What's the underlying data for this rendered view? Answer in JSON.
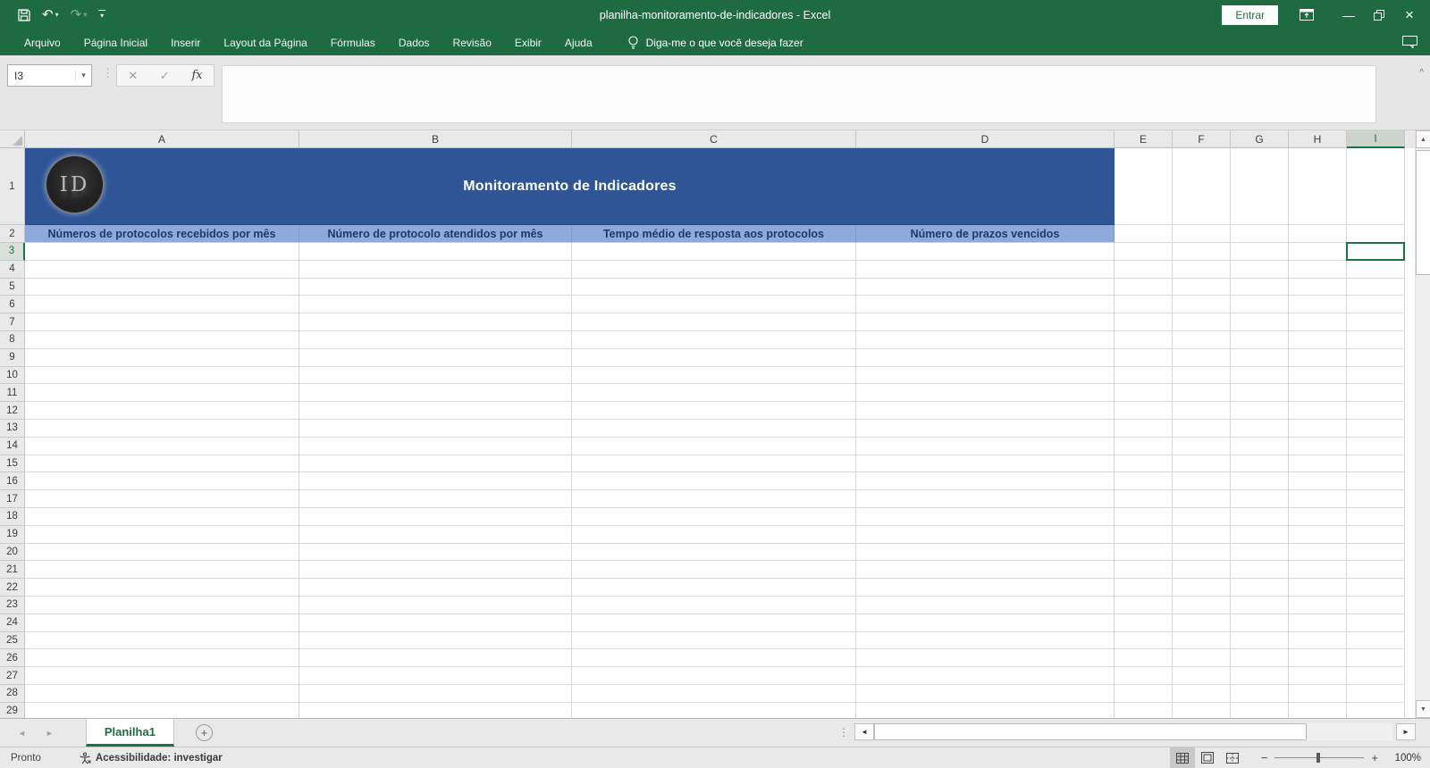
{
  "titlebar": {
    "title": "planilha-monitoramento-de-indicadores  -  Excel",
    "signin": "Entrar"
  },
  "menubar": {
    "tabs": [
      "Arquivo",
      "Página Inicial",
      "Inserir",
      "Layout da Página",
      "Fórmulas",
      "Dados",
      "Revisão",
      "Exibir",
      "Ajuda"
    ],
    "tell_me": "Diga-me o que você deseja fazer"
  },
  "formula_bar": {
    "name_box": "I3",
    "value": ""
  },
  "grid": {
    "column_letters": [
      "A",
      "B",
      "C",
      "D",
      "E",
      "F",
      "G",
      "H",
      "I"
    ],
    "first_row": 1,
    "last_row": 29,
    "selection": {
      "cell": "I3",
      "column": "I",
      "row": 3
    },
    "banner": {
      "title": "Monitoramento de Indicadores",
      "logo_text": "ID"
    },
    "header_row": [
      "Números de protocolos recebidos por mês",
      "Número de protocolo atendidos por mês",
      "Tempo médio de resposta aos protocolos",
      "Número de prazos vencidos"
    ]
  },
  "sheet_tabs": {
    "active": "Planilha1"
  },
  "status_bar": {
    "mode": "Pronto",
    "accessibility": "Acessibilidade: investigar",
    "zoom_level": "100%"
  },
  "colors": {
    "excel_green": "#1E6B41",
    "selection_green": "#1E7145",
    "banner_blue": "#2F5597",
    "header_blue": "#8EAADB",
    "header_text_navy": "#1F3864"
  },
  "icons": {
    "undo": "↶",
    "redo": "↷",
    "dropdown": "▾",
    "minimize": "—",
    "close": "×",
    "dots": "⋮",
    "cancel": "✕",
    "enter": "✓",
    "fx": "fx",
    "collapse_formula_bar": "^",
    "scroll_up": "▲",
    "scroll_down": "▼",
    "scroll_left": "◄",
    "scroll_right": "►",
    "tab_prev": "◄",
    "tab_next": "►",
    "add_sheet": "+",
    "zoom_out": "−",
    "zoom_in": "+"
  }
}
